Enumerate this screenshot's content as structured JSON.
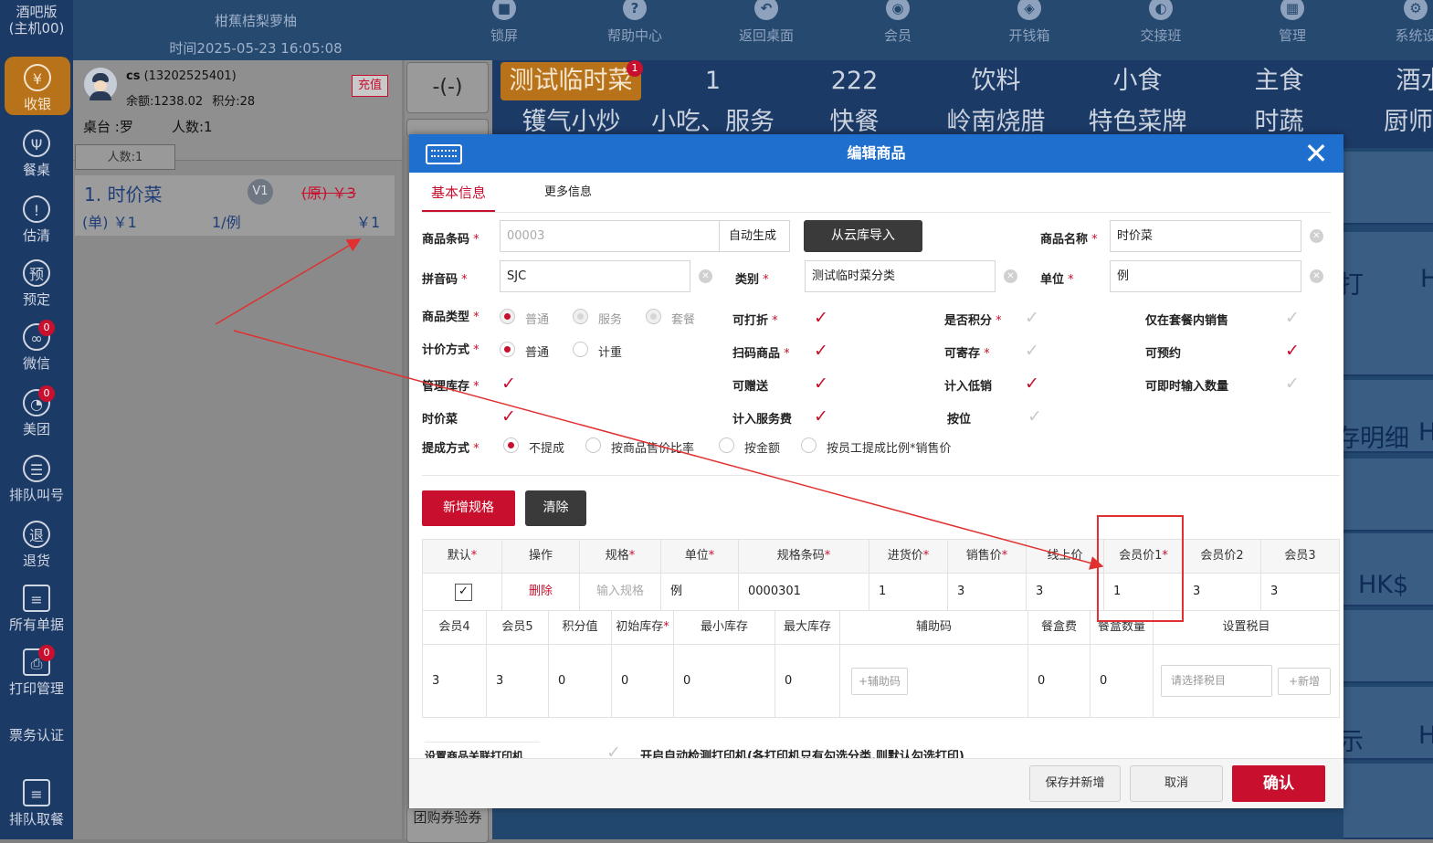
{
  "sidebar": {
    "version_line1": "酒吧版",
    "version_line2": "(主机00)",
    "items": [
      {
        "label": "收银",
        "glyph": "¥",
        "icon": "yen-icon"
      },
      {
        "label": "餐桌",
        "glyph": "Ψ",
        "icon": "dining-icon"
      },
      {
        "label": "估清",
        "glyph": "!",
        "icon": "warning-icon"
      },
      {
        "label": "预定",
        "glyph": "预",
        "icon": "reserve-icon"
      },
      {
        "label": "微信",
        "glyph": "∞",
        "icon": "wechat-icon",
        "badge": "0"
      },
      {
        "label": "美团",
        "glyph": "◔",
        "icon": "meituan-icon",
        "badge": "0"
      },
      {
        "label": "排队叫号",
        "glyph": "☰",
        "icon": "queue-icon"
      },
      {
        "label": "退货",
        "glyph": "退",
        "icon": "return-icon"
      },
      {
        "label": "所有单据",
        "glyph": "≡",
        "icon": "documents-icon"
      },
      {
        "label": "打印管理",
        "glyph": "⎙",
        "icon": "printer-icon",
        "badge": "0"
      },
      {
        "label": "票务认证",
        "glyph": "",
        "icon": ""
      },
      {
        "label": "排队取餐",
        "glyph": "≡",
        "icon": "pickup-icon"
      }
    ]
  },
  "header": {
    "store_name": "柑蕉桔梨萝柚",
    "time_text": "时间2025-05-23 16:05:08",
    "buttons": [
      {
        "label": "锁屏",
        "glyph": "■",
        "icon": "lock-icon"
      },
      {
        "label": "帮助中心",
        "glyph": "?",
        "icon": "help-icon"
      },
      {
        "label": "返回桌面",
        "glyph": "↶",
        "icon": "back-icon"
      },
      {
        "label": "会员",
        "glyph": "◉",
        "icon": "member-icon"
      },
      {
        "label": "开钱箱",
        "glyph": "◈",
        "icon": "cashbox-icon"
      },
      {
        "label": "交接班",
        "glyph": "◐",
        "icon": "shift-icon"
      },
      {
        "label": "管理",
        "glyph": "▦",
        "icon": "manage-icon"
      },
      {
        "label": "系统设",
        "glyph": "⚙",
        "icon": "settings-icon"
      }
    ]
  },
  "order": {
    "customer_name": "cs",
    "customer_phone": "(13202525401)",
    "balance": "余额:1238.02",
    "points": "积分:28",
    "charge_label": "充值",
    "table": "桌台 :罗",
    "people": "人数:1",
    "people_button": "人数:1",
    "item_name": "1. 时价菜",
    "item_badge": "V1",
    "item_original": "(原) ￥3",
    "item_unit_price": "(单) ￥1",
    "item_qty": "1/例",
    "item_total": "￥1"
  },
  "keypad": {
    "minus_label": "-(-)",
    "bottom_label": "团购券验券"
  },
  "categories": {
    "row1": [
      "测试临时菜",
      "1",
      "222",
      "饮料",
      "小食",
      "主食",
      "酒水"
    ],
    "row2": [
      "镬气小炒",
      "小吃、服务",
      "快餐",
      "岭南烧腊",
      "特色菜牌",
      "时蔬",
      "厨师长"
    ],
    "selected_badge": "1"
  },
  "tiles": {
    "texts": [
      "打",
      "H",
      "存明细",
      "H",
      "HK$",
      "示",
      "H"
    ]
  },
  "dialog": {
    "title": "编辑商品",
    "tabs": [
      "基本信息",
      "更多信息"
    ],
    "fields": {
      "barcode_label": "商品条码",
      "barcode_placeholder": "00003",
      "auto_generate": "自动生成",
      "import_cloud": "从云库导入",
      "name_label": "商品名称",
      "name_value": "时价菜",
      "pinyin_label": "拼音码",
      "pinyin_value": "SJC",
      "category_label": "类别",
      "category_value": "测试临时菜分类",
      "unit_label": "单位",
      "unit_value": "例"
    },
    "product_type": {
      "label": "商品类型",
      "options": [
        "普通",
        "服务",
        "套餐"
      ]
    },
    "pricing": {
      "label": "计价方式",
      "options": [
        "普通",
        "计重"
      ]
    },
    "commission": {
      "label": "提成方式",
      "options": [
        "不提成",
        "按商品售价比率",
        "按金额",
        "按员工提成比例*销售价"
      ]
    },
    "checks": {
      "discount": "可打折",
      "points": "是否积分",
      "package_only": "仅在套餐内销售",
      "scan": "扫码商品",
      "deposit": "可寄存",
      "reserve": "可预约",
      "stock": "管理库存",
      "gift": "可赠送",
      "low_sale": "计入低销",
      "instant_qty": "可即时输入数量",
      "market_price": "时价菜",
      "service_fee": "计入服务费",
      "by_seat": "按位"
    },
    "spec_buttons": {
      "add": "新增规格",
      "clear": "清除"
    },
    "table1": {
      "headers": [
        "默认",
        "操作",
        "规格",
        "单位",
        "规格条码",
        "进货价",
        "销售价",
        "线上价",
        "会员价1",
        "会员价2",
        "会员3"
      ],
      "row": {
        "delete": "删除",
        "spec_placeholder": "输入规格",
        "unit": "例",
        "barcode": "0000301",
        "purchase": "1",
        "sale": "3",
        "online": "3",
        "member1": "1",
        "member2": "3",
        "member3": "3"
      }
    },
    "table2": {
      "headers": [
        "会员4",
        "会员5",
        "积分值",
        "初始库存",
        "最小库存",
        "最大库存",
        "辅助码",
        "餐盒费",
        "餐盒数量",
        "设置税目"
      ],
      "row": {
        "m4": "3",
        "m5": "3",
        "points": "0",
        "init_stock": "0",
        "min_stock": "0",
        "max_stock": "0",
        "aux_btn": "+辅助码",
        "box_fee": "0",
        "box_qty": "0",
        "tax_placeholder": "请选择税目",
        "tax_add": "+新增"
      }
    },
    "printer": {
      "label": "设置商品关联打印机",
      "auto_detect": "开启自动检测打印机(各打印机只有勾选分类,则默认勾选打印)"
    },
    "footer": {
      "save_new": "保存并新增",
      "cancel": "取消",
      "confirm": "确认"
    }
  },
  "colors": {
    "brand": "#1f6fce",
    "accent": "#c8102e",
    "sidebar": "#1c3a66",
    "active": "#b8721a"
  }
}
